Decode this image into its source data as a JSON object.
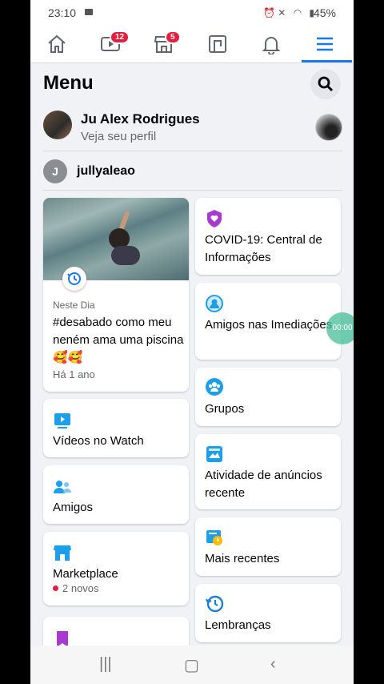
{
  "status": {
    "time": "23:10",
    "battery": "45%"
  },
  "nav": {
    "tabs": [
      "home",
      "watch",
      "marketplace",
      "pages",
      "notifications",
      "menu"
    ],
    "watch_badge": "12",
    "marketplace_badge": "5",
    "active_color": "#1877f2"
  },
  "header": {
    "title": "Menu"
  },
  "profile": {
    "name": "Ju Alex Rodrigues",
    "subtitle": "Veja seu perfil"
  },
  "account": {
    "initial": "J",
    "name": "jullyaleao"
  },
  "memory": {
    "label": "Neste Dia",
    "text": "#desabado como meu neném ama uma piscina 🥰🥰",
    "time": "Há 1 ano"
  },
  "left_cards": [
    {
      "label": "Vídeos no Watch",
      "icon": "watch-video-icon"
    },
    {
      "label": "Amigos",
      "icon": "friends-icon"
    },
    {
      "label": "Marketplace",
      "icon": "marketplace-icon",
      "sub": "2 novos"
    },
    {
      "label": "",
      "icon": "saved-icon"
    }
  ],
  "right_cards": [
    {
      "label": "COVID-19: Central de Informações",
      "icon": "covid-heart-icon"
    },
    {
      "label": "Amigos nas Imediações",
      "icon": "nearby-friends-icon"
    },
    {
      "label": "Grupos",
      "icon": "groups-icon"
    },
    {
      "label": "Atividade de anúncios recente",
      "icon": "ad-activity-icon"
    },
    {
      "label": "Mais recentes",
      "icon": "most-recent-icon"
    },
    {
      "label": "Lembranças",
      "icon": "memories-icon"
    }
  ],
  "overlay_timer": "00:00"
}
